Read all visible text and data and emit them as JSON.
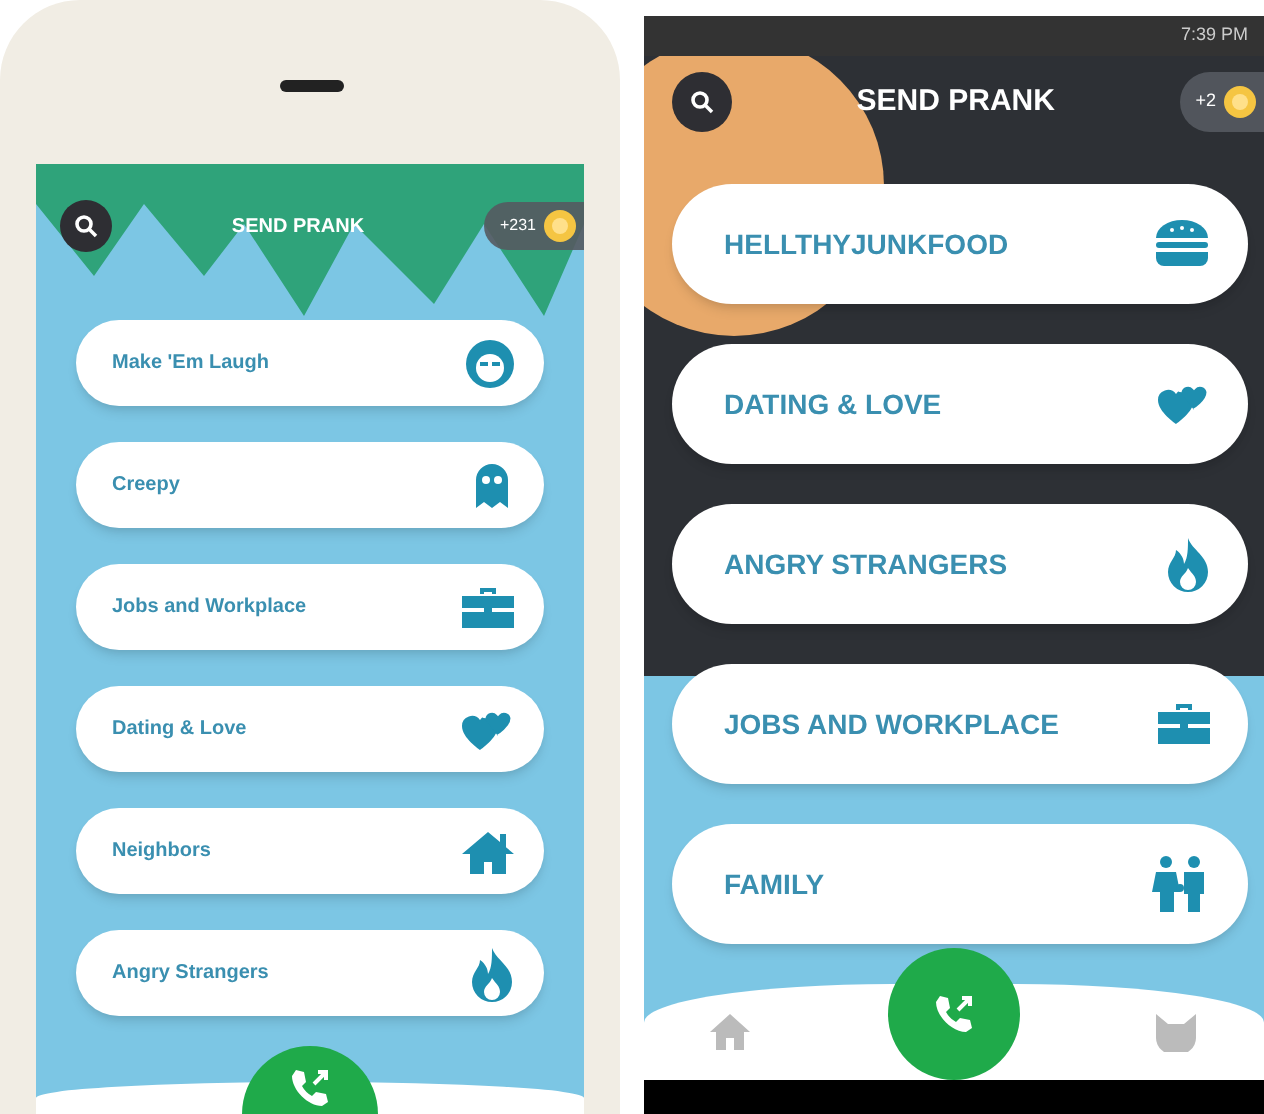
{
  "screens": [
    {
      "kind": "ios",
      "title": "SEND PRANK",
      "coins": "+231",
      "categories": [
        {
          "label": "Make 'Em Laugh",
          "kind": "face"
        },
        {
          "label": "Creepy",
          "kind": "ghost"
        },
        {
          "label": "Jobs and Workplace",
          "kind": "briefcase"
        },
        {
          "label": "Dating & Love",
          "kind": "hearts"
        },
        {
          "label": "Neighbors",
          "kind": "house"
        },
        {
          "label": "Angry Strangers",
          "kind": "flame"
        }
      ]
    },
    {
      "kind": "android",
      "title": "SEND PRANK",
      "coins": "+2",
      "clock": "7:39 PM",
      "categories": [
        {
          "label": "HELLTHYJUNKFOOD",
          "kind": "burger"
        },
        {
          "label": "DATING & LOVE",
          "kind": "hearts"
        },
        {
          "label": "ANGRY STRANGERS",
          "kind": "flame"
        },
        {
          "label": "JOBS AND WORKPLACE",
          "kind": "briefcase"
        },
        {
          "label": "FAMILY",
          "kind": "family"
        }
      ]
    }
  ]
}
